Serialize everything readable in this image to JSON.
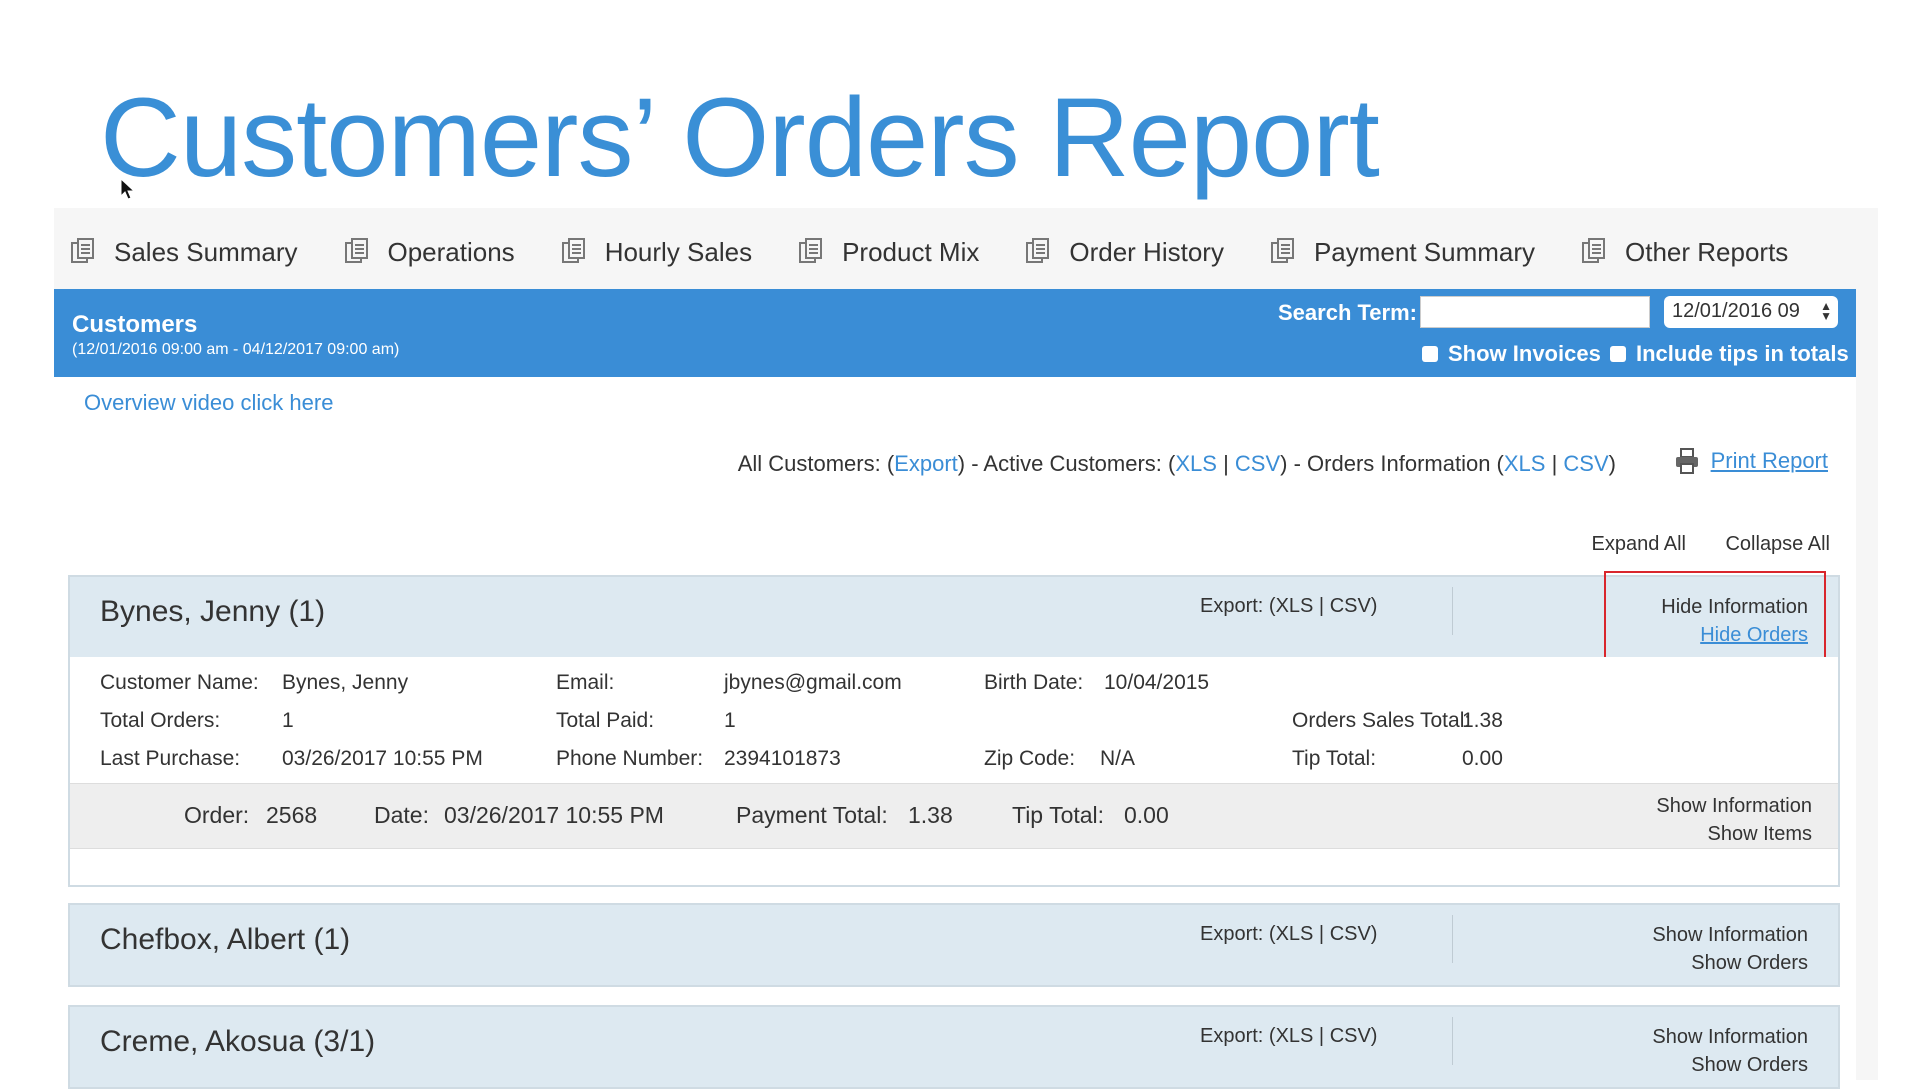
{
  "slide": {
    "title": "Customers’ Orders Report"
  },
  "tabs": [
    {
      "label": "Sales Summary"
    },
    {
      "label": "Operations"
    },
    {
      "label": "Hourly Sales"
    },
    {
      "label": "Product Mix"
    },
    {
      "label": "Order History"
    },
    {
      "label": "Payment Summary"
    },
    {
      "label": "Other Reports"
    }
  ],
  "header": {
    "title": "Customers",
    "range": "(12/01/2016 09:00 am - 04/12/2017 09:00 am)",
    "search_label": "Search Term:",
    "search_value": "",
    "date_value": "12/01/2016 09",
    "show_invoices": "Show Invoices",
    "include_tips": "Include tips in totals"
  },
  "links": {
    "overview": "Overview video click here",
    "all_customers": "All Customers: (",
    "export": "Export",
    "active_customers": ") - Active Customers: (",
    "xls": "XLS",
    "sep": " | ",
    "csv": "CSV",
    "orders_info": ") - Orders Information (",
    "close": ")",
    "print_report": "Print Report",
    "expand_all": "Expand All",
    "collapse_all": "Collapse All"
  },
  "customers": [
    {
      "name": "Bynes, Jenny (1)",
      "export": "Export: (XLS | CSV)",
      "action1": "Hide Information",
      "action2": "Hide Orders",
      "details": {
        "customer_name_label": "Customer Name:",
        "customer_name": "Bynes, Jenny",
        "email_label": "Email:",
        "email": "jbynes@gmail.com",
        "birth_label": "Birth Date:",
        "birth": "10/04/2015",
        "total_orders_label": "Total Orders:",
        "total_orders": "1",
        "total_paid_label": "Total Paid:",
        "total_paid": "1",
        "sales_total_label": "Orders Sales Total:",
        "sales_total": "1.38",
        "last_purchase_label": "Last Purchase:",
        "last_purchase": "03/26/2017 10:55 PM",
        "phone_label": "Phone Number:",
        "phone": "2394101873",
        "zip_label": "Zip Code:",
        "zip": "N/A",
        "tip_label": "Tip Total:",
        "tip": "0.00"
      },
      "order": {
        "order_label": "Order:",
        "order": "2568",
        "date_label": "Date:",
        "date": "03/26/2017 10:55 PM",
        "payment_label": "Payment Total:",
        "payment": "1.38",
        "tip_label": "Tip Total:",
        "tip": "0.00",
        "action1": "Show Information",
        "action2": "Show Items"
      }
    },
    {
      "name": "Chefbox, Albert (1)",
      "export": "Export: (XLS | CSV)",
      "action1": "Show Information",
      "action2": "Show Orders"
    },
    {
      "name": "Creme, Akosua (3/1)",
      "export": "Export: (XLS | CSV)",
      "action1": "Show Information",
      "action2": "Show Orders"
    }
  ],
  "colors": {
    "accent": "#3a8dd6",
    "highlight": "#d9262c",
    "row_bg": "#dde9f1"
  }
}
